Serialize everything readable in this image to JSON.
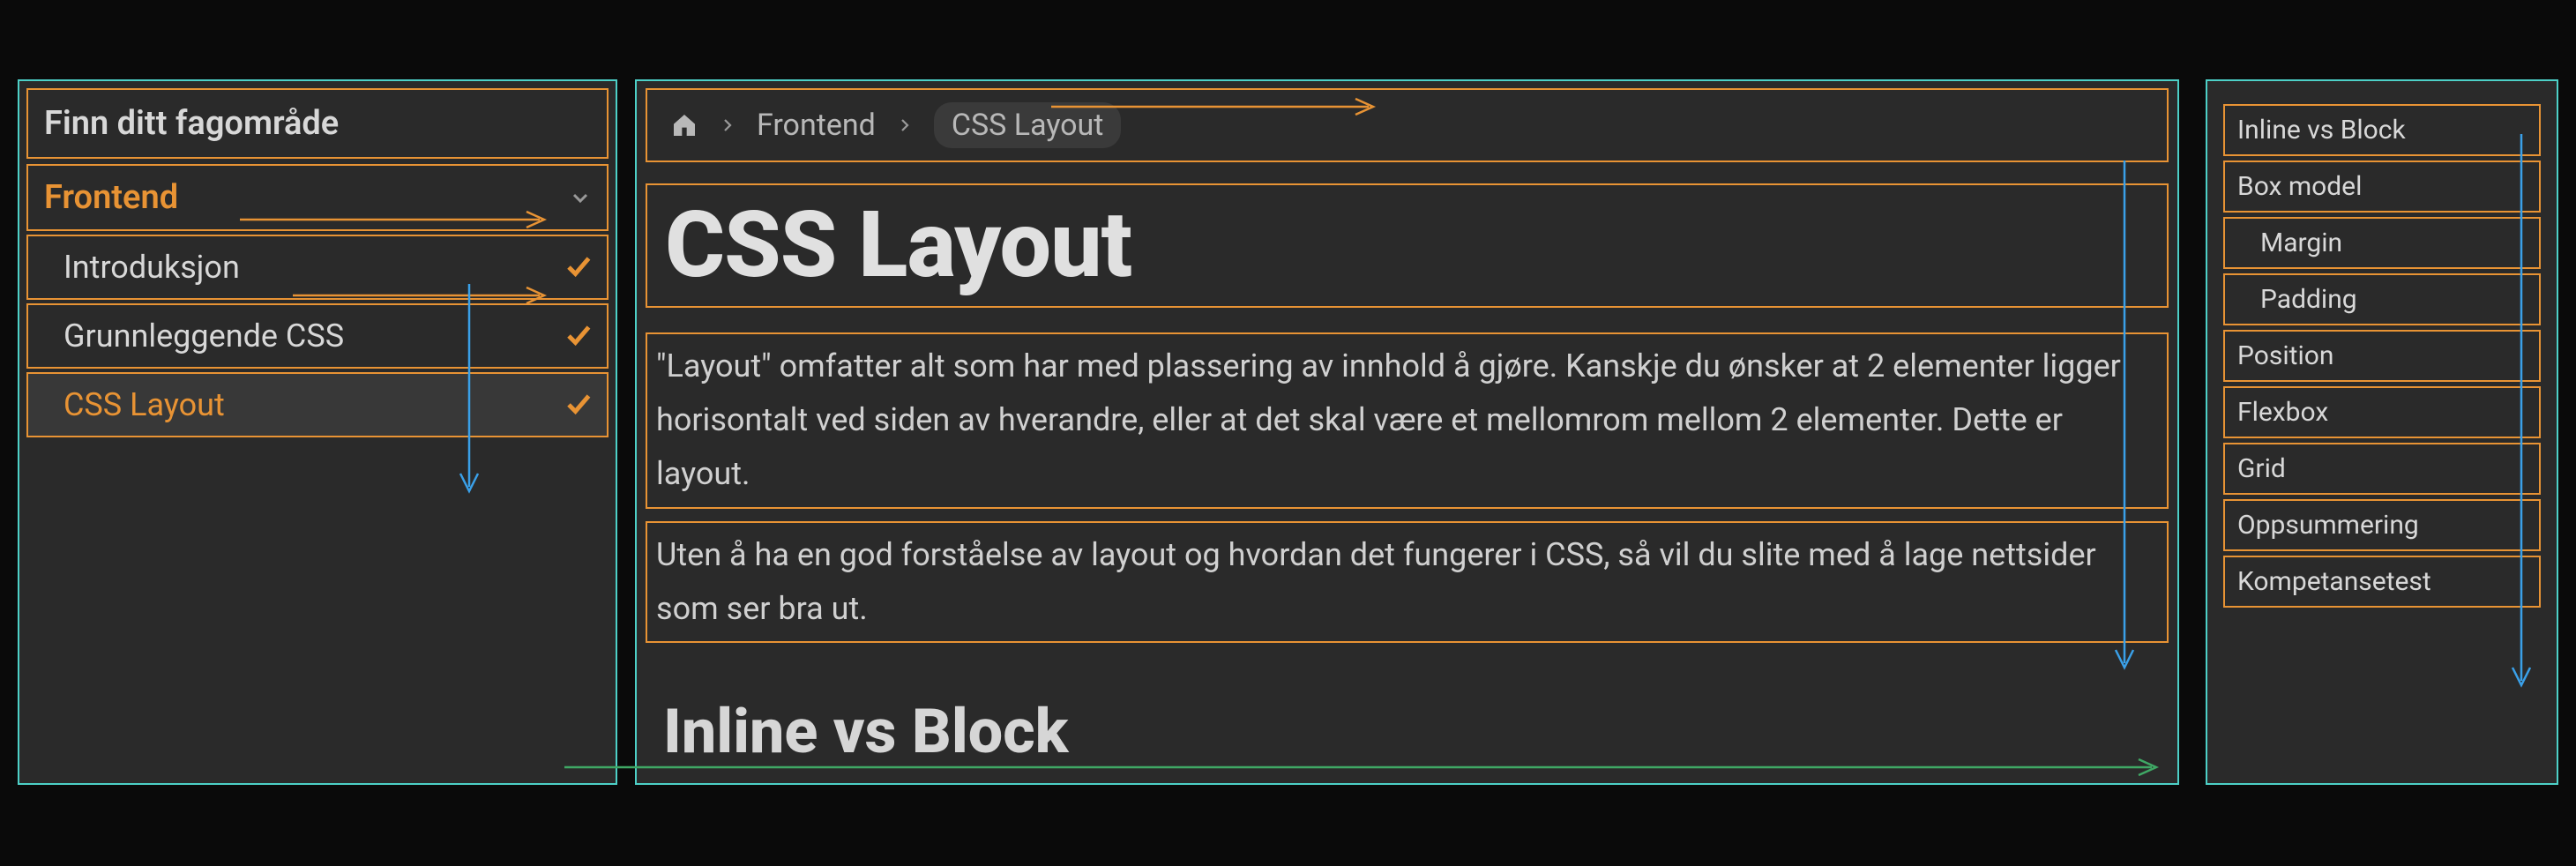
{
  "sidebar": {
    "title": "Finn ditt fagområde",
    "category": {
      "label": "Frontend"
    },
    "items": [
      {
        "label": "Introduksjon",
        "completed": true,
        "active": false
      },
      {
        "label": "Grunnleggende CSS",
        "completed": true,
        "active": false
      },
      {
        "label": "CSS Layout",
        "completed": true,
        "active": true
      }
    ]
  },
  "breadcrumb": {
    "home_icon": "home-icon",
    "items": [
      {
        "label": "Frontend",
        "current": false
      },
      {
        "label": "CSS Layout",
        "current": true
      }
    ]
  },
  "main": {
    "title": "CSS Layout",
    "paragraphs": [
      "\"Layout\" omfatter alt som har med plassering av innhold å gjøre. Kanskje du ønsker at 2 elementer ligger horisontalt ved siden av hverandre, eller at det skal være et mellomrom mellom 2 elementer. Dette er layout.",
      "Uten å ha en god forståelse av layout og hvordan det fungerer i CSS, så vil du slite med å lage nettsider som ser bra ut."
    ],
    "next_heading": "Inline vs Block"
  },
  "toc": {
    "items": [
      {
        "label": "Inline vs Block",
        "sub": false
      },
      {
        "label": "Box model",
        "sub": false
      },
      {
        "label": "Margin",
        "sub": true
      },
      {
        "label": "Padding",
        "sub": true
      },
      {
        "label": "Position",
        "sub": false
      },
      {
        "label": "Flexbox",
        "sub": false
      },
      {
        "label": "Grid",
        "sub": false
      },
      {
        "label": "Oppsummering",
        "sub": false
      },
      {
        "label": "Kompetansetest",
        "sub": false
      }
    ]
  }
}
